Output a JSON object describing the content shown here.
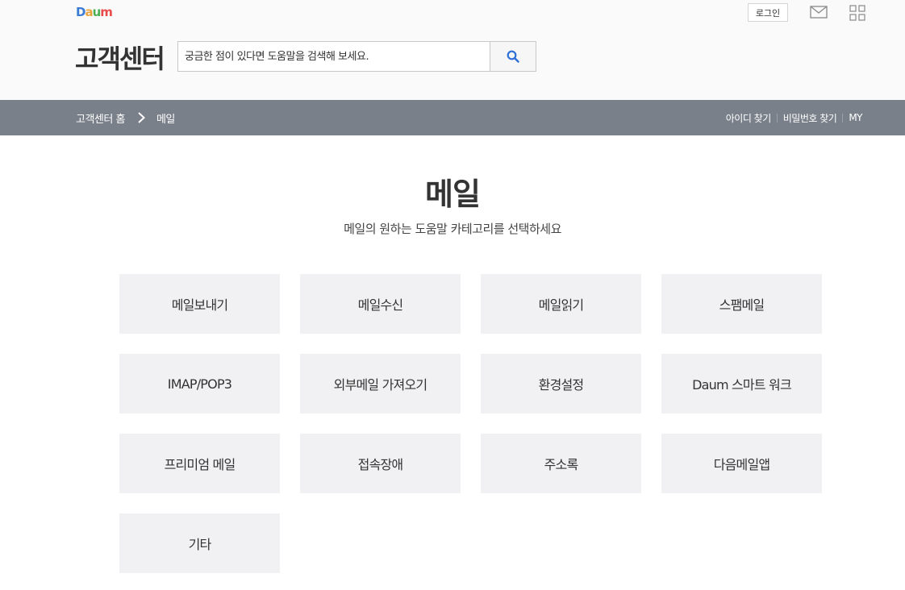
{
  "header": {
    "logo": [
      "D",
      "a",
      "u",
      "m"
    ],
    "login_label": "로그인",
    "title": "고객센터",
    "search_placeholder": "궁금한 점이 있다면 도움말을 검색해 보세요."
  },
  "nav": {
    "breadcrumb_home": "고객센터 홈",
    "breadcrumb_current": "메일",
    "links": [
      "아이디 찾기",
      "비밀번호 찾기",
      "MY"
    ]
  },
  "main": {
    "heading": "메일",
    "subheading": "메일의 원하는 도움말 카테고리를 선택하세요",
    "categories": [
      "메일보내기",
      "메일수신",
      "메일읽기",
      "스팸메일",
      "IMAP/POP3",
      "외부메일 가져오기",
      "환경설정",
      "Daum 스마트 워크",
      "프리미엄 메일",
      "접속장애",
      "주소록",
      "다음메일앱",
      "기타"
    ]
  },
  "icons": {
    "mail": "mail-icon",
    "apps": "apps-grid-icon",
    "search": "search-icon",
    "chevron": "chevron-right-icon"
  },
  "colors": {
    "nav_bg": "#7a808a",
    "card_bg": "#f1f1f3",
    "search_icon": "#2e6fd6"
  }
}
